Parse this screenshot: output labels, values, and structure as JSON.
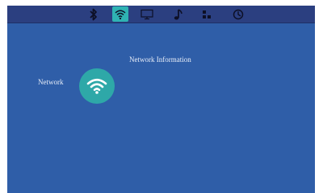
{
  "topbar": {
    "tabs": [
      {
        "icon": "bluetooth-icon",
        "selected": false
      },
      {
        "icon": "wifi-icon",
        "selected": true
      },
      {
        "icon": "display-icon",
        "selected": false
      },
      {
        "icon": "music-note-icon",
        "selected": false
      },
      {
        "icon": "apps-icon",
        "selected": false
      },
      {
        "icon": "clock-icon",
        "selected": false
      }
    ]
  },
  "main": {
    "section_title": "Network Information",
    "network_label": "Network",
    "network_icon": "wifi-icon"
  },
  "colors": {
    "background": "#2f5ea8",
    "topbar": "#2b3f80",
    "accent": "#2fb3b3",
    "text": "#e8eef8"
  }
}
